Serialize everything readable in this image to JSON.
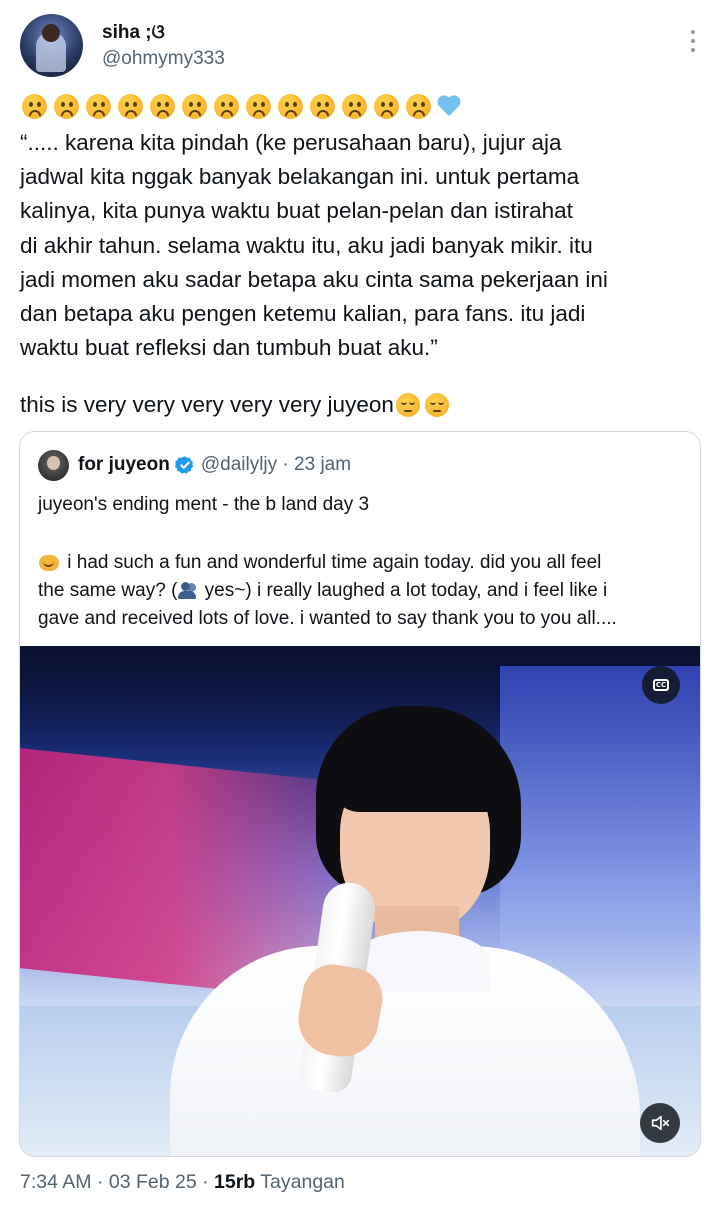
{
  "author": {
    "name": "siha ;ଓ",
    "handle": "@ohmymy333"
  },
  "tweet": {
    "emoji_row": [
      "frowning-face-icon",
      "frowning-face-icon",
      "frowning-face-icon",
      "frowning-face-icon",
      "frowning-face-icon",
      "frowning-face-icon",
      "frowning-face-icon",
      "frowning-face-icon",
      "frowning-face-icon",
      "frowning-face-icon",
      "frowning-face-icon",
      "frowning-face-icon",
      "frowning-face-icon",
      "light-blue-heart-icon"
    ],
    "lines": [
      "“..... karena kita pindah (ke perusahaan baru), jujur aja",
      "jadwal kita nggak banyak belakangan ini. untuk pertama",
      "kalinya, kita punya waktu buat pelan-pelan dan istirahat",
      "di akhir tahun. selama waktu itu, aku jadi banyak mikir. itu",
      "jadi momen aku sadar betapa aku cinta sama pekerjaan ini",
      "dan betapa aku pengen ketemu kalian, para fans. itu jadi",
      "waktu buat refleksi dan tumbuh buat aku.”"
    ],
    "closing": "this is very very very very very juyeon",
    "closing_emojis": [
      "relieved-face-icon",
      "relieved-face-icon"
    ]
  },
  "quoted": {
    "name": "for juyeon",
    "verified": true,
    "handle_time": "@dailyljy · 23 jam",
    "title": "juyeon's ending ment - the b land day 3",
    "body_lines": [
      "i had such a fun and wonderful time again today. did you all feel",
      "the same way? (",
      " yes~) i really laughed a lot today, and i feel like i",
      "gave and received lots of love. i wanted to say thank you to you all...."
    ],
    "media": {
      "type": "video",
      "cc_label": "CC",
      "controls": [
        "closed-captions-icon",
        "volume-muted-icon"
      ]
    }
  },
  "footer": {
    "time_date": "7:34 AM · 03 Feb 25 · ",
    "views_count": "15rb",
    "views_label": " Tayangan"
  },
  "colors": {
    "text": "#0f1419",
    "secondary": "#536471",
    "border": "#cfd9de",
    "verified": "#1d9bf0"
  }
}
